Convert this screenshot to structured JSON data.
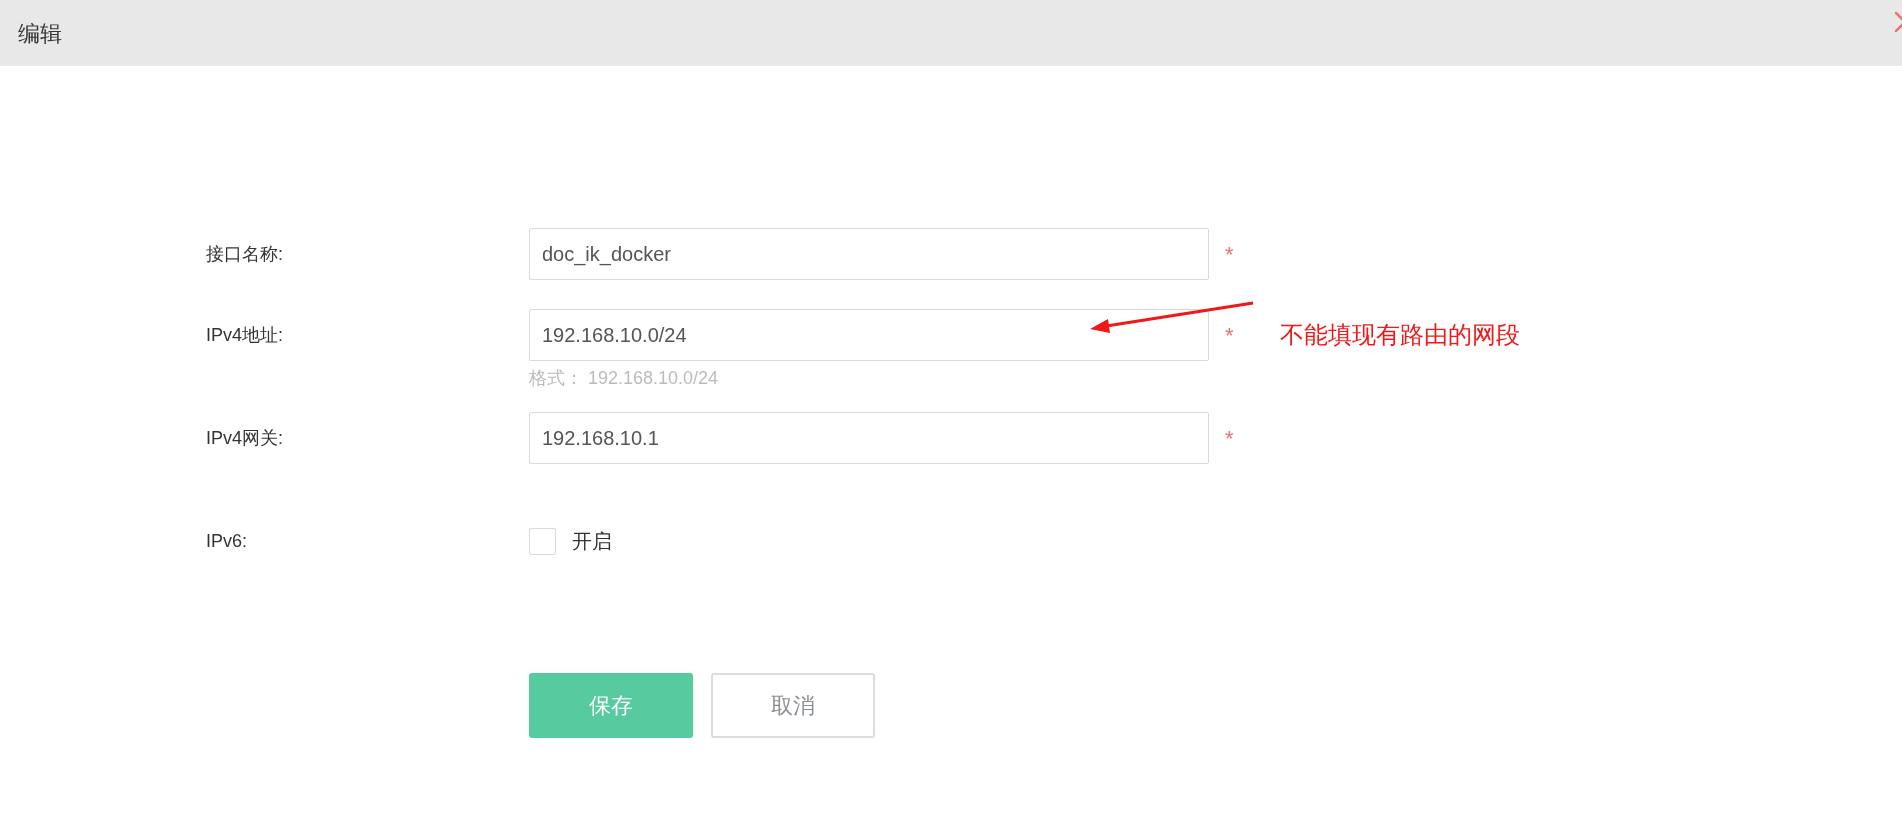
{
  "dialog": {
    "title": "编辑"
  },
  "fields": [
    {
      "kind": "input",
      "label": "接口名称:",
      "value": "doc_ik_docker",
      "required_mark": "*"
    },
    {
      "kind": "input",
      "label": "IPv4地址:",
      "value": "192.168.10.0/24",
      "required_mark": "*",
      "hint": "格式： 192.168.10.0/24",
      "annotation": "不能填现有路由的网段"
    },
    {
      "kind": "input",
      "label": "IPv4网关:",
      "value": "192.168.10.1",
      "required_mark": "*"
    },
    {
      "kind": "checkbox",
      "label": "IPv6:",
      "option": "开启",
      "checked": false
    }
  ],
  "buttons": [
    {
      "kind": "primary",
      "label": "保存"
    },
    {
      "kind": "secondary",
      "label": "取消"
    }
  ]
}
